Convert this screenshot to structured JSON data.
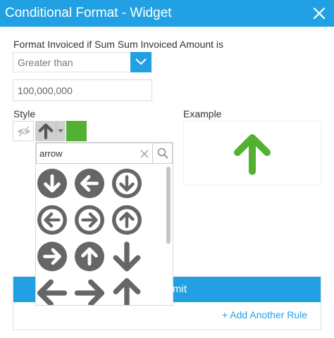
{
  "window": {
    "title": "Conditional Format - Widget",
    "close_icon": "close-icon"
  },
  "condition": {
    "label": "Format Invoiced if Sum Sum Invoiced Amount is",
    "operator": "Greater than",
    "dropdown_icon": "chevron-down-icon",
    "value": "100,000,000"
  },
  "style": {
    "label": "Style",
    "hide_icon": "eye-slash-icon",
    "selected_icon": "arrow-up-icon",
    "color": "#52b033"
  },
  "example": {
    "label": "Example",
    "icon": "arrow-up-icon",
    "color": "#52b033"
  },
  "icon_picker": {
    "search_value": "arrow",
    "clear_icon": "close-icon",
    "search_icon": "search-icon",
    "icon_color": "#666666",
    "icons": [
      "arrow-circle-down-icon",
      "arrow-circle-left-icon",
      "arrow-circle-o-down-icon",
      "arrow-circle-o-left-icon",
      "arrow-circle-o-right-icon",
      "arrow-circle-o-up-icon",
      "arrow-circle-right-icon",
      "arrow-circle-up-icon",
      "arrow-down-icon",
      "arrow-left-icon",
      "arrow-right-icon",
      "arrow-up-icon"
    ]
  },
  "footer": {
    "bar_text": "mit",
    "add_rule": "+ Add Another Rule"
  },
  "colors": {
    "accent": "#21a1e3",
    "green": "#52b033"
  }
}
